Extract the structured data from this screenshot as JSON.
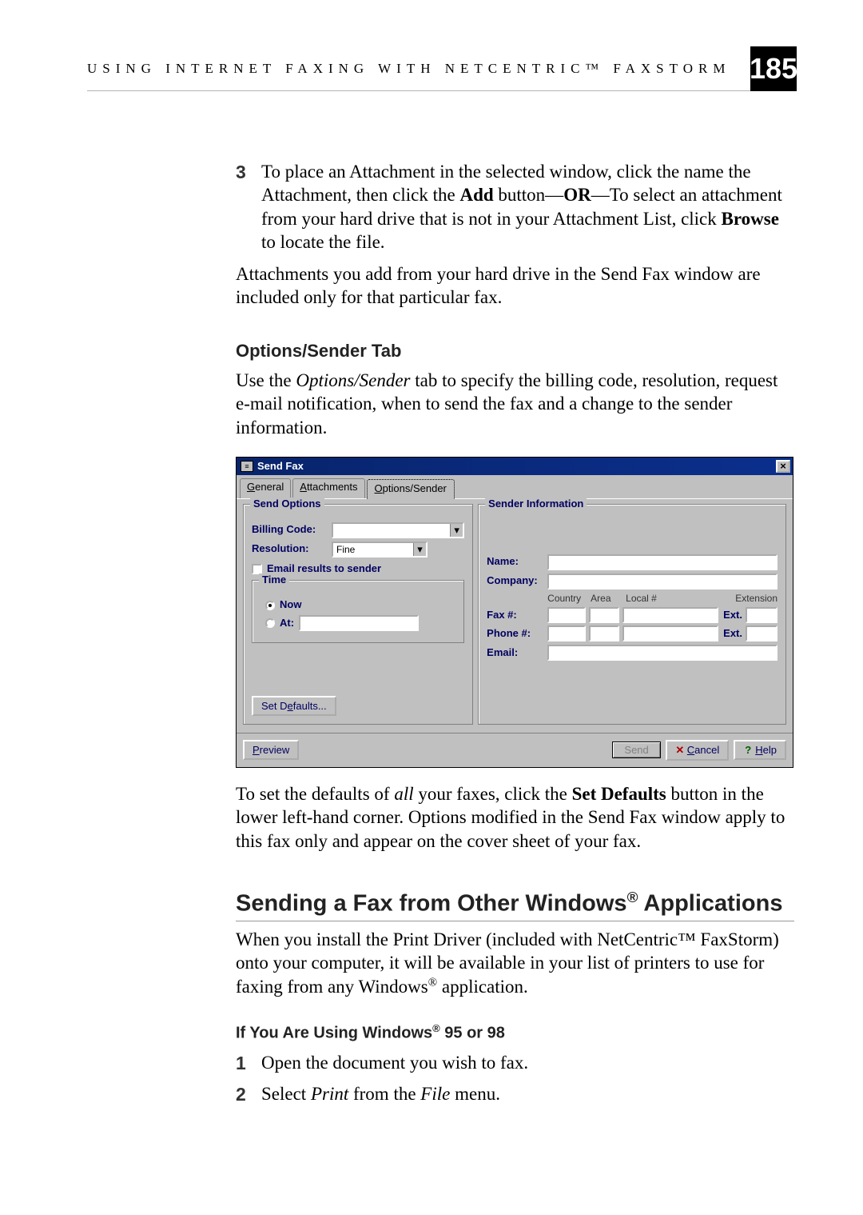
{
  "header": {
    "running_head": "USING INTERNET FAXING WITH NETCENTRIC™ FAXSTORM",
    "page_number": "185"
  },
  "step3": {
    "num": "3",
    "text_pre": "To place an Attachment in the selected window, click the name the Attachment, then click the ",
    "add": "Add",
    "mid1": " button—",
    "or": "OR",
    "mid2": "—To select an attachment from your hard drive that is not in your Attachment List, click ",
    "browse": "Browse",
    "text_post": " to locate the file."
  },
  "para_attach": "Attachments you add from your hard drive in the Send Fax window are included only for that particular fax.",
  "h2_options": "Options/Sender Tab",
  "para_options_pre": "Use the ",
  "para_options_italic": "Options/Sender",
  "para_options_post": " tab to specify the billing code, resolution, request e-mail notification, when to send the fax and a change to the sender information.",
  "dialog": {
    "title": "Send Fax",
    "tabs": {
      "general": "General",
      "attachments": "Attachments",
      "options": "Options/Sender"
    },
    "send_options": {
      "legend": "Send Options",
      "billing_code": "Billing Code:",
      "resolution": "Resolution:",
      "resolution_value": "Fine",
      "email_results": "Email results to sender",
      "time_legend": "Time",
      "now": "Now",
      "at": "At:",
      "set_defaults": "Set Defaults..."
    },
    "sender": {
      "legend": "Sender Information",
      "name": "Name:",
      "company": "Company:",
      "country": "Country",
      "area": "Area",
      "local": "Local #",
      "extension": "Extension",
      "fax": "Fax #:",
      "phone": "Phone #:",
      "ext": "Ext.",
      "email": "Email:"
    },
    "footer": {
      "preview": "Preview",
      "send": "Send",
      "cancel": "Cancel",
      "help": "Help"
    }
  },
  "para_defaults_pre": "To set the defaults of ",
  "para_defaults_all": "all",
  "para_defaults_mid": " your faxes, click the ",
  "para_defaults_set": "Set Defaults",
  "para_defaults_post": " button in the lower left-hand corner. Options modified in the Send Fax window apply to this fax only and appear on the cover sheet of your fax.",
  "h1_sending_pre": "Sending a Fax from Other Windows",
  "h1_sending_sup": "®",
  "h1_sending_post": " Applications",
  "para_install_pre": "When you install the Print Driver (included with NetCentric™ FaxStorm) onto your computer, it will be available in your list of printers to use for faxing from any Windows",
  "para_install_sup": "®",
  "para_install_post": " application.",
  "h3_ifyou_pre": "If You Are Using Windows",
  "h3_ifyou_sup": "®",
  "h3_ifyou_post": " 95 or 98",
  "step1": {
    "num": "1",
    "text": "Open the document you wish to fax."
  },
  "step2": {
    "num": "2",
    "pre": "Select ",
    "print": "Print",
    "mid": " from the ",
    "file": "File",
    "post": " menu."
  }
}
